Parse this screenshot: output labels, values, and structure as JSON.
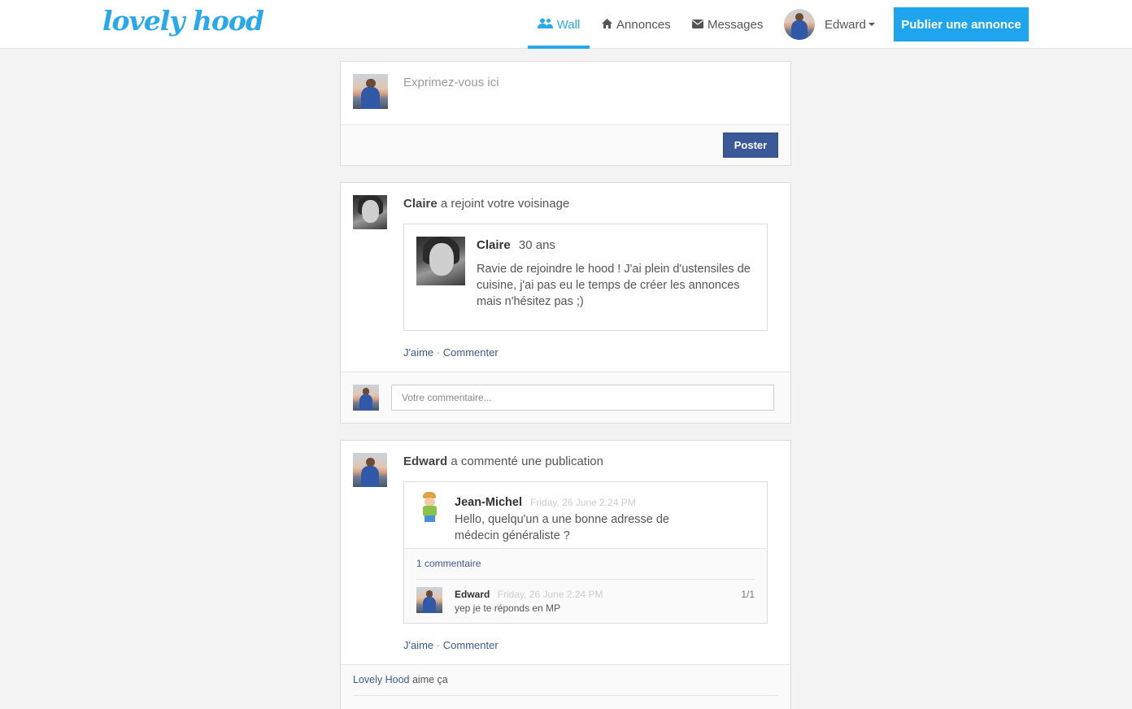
{
  "brand": {
    "logo_text": "lovely hood",
    "accent": "#2aa9ea",
    "facebook_blue": "#3b5998"
  },
  "nav": {
    "wall": {
      "label": "Wall",
      "icon": "users-icon"
    },
    "annonces": {
      "label": "Annonces",
      "icon": "home-icon"
    },
    "messages": {
      "label": "Messages",
      "icon": "envelope-icon"
    },
    "user": {
      "label": "Edward"
    },
    "publish_label": "Publier une annonce"
  },
  "composer": {
    "placeholder": "Exprimez-vous ici",
    "post_label": "Poster"
  },
  "posts": [
    {
      "actor": "Claire",
      "action": "a rejoint votre voisinage",
      "profile": {
        "name": "Claire",
        "age": "30 ans",
        "bio": "Ravie de rejoindre le hood ! J'ai plein d'ustensiles de cuisine, j'ai pas eu le temps de créer les annonces mais n'hésitez pas ;)"
      },
      "like_label": "J'aime",
      "separator": "·",
      "comment_label": "Commenter",
      "comment_placeholder": "Votre commentaire..."
    },
    {
      "actor": "Edward",
      "action": "a commenté une publication",
      "original": {
        "author": "Jean-Michel",
        "time": "Friday, 26 June 2:24 PM",
        "text": "Hello, quelqu'un a une bonne adresse de médecin généraliste ?",
        "comments_count": "1 commentaire",
        "comment": {
          "author": "Edward",
          "time": "Friday, 26 June 2:24 PM",
          "text": "yep je te réponds en MP",
          "page": "1/1"
        }
      },
      "like_label": "J'aime",
      "separator": "·",
      "comment_label": "Commenter",
      "likes": {
        "who": "Lovely Hood",
        "text": "aime ça"
      }
    }
  ]
}
